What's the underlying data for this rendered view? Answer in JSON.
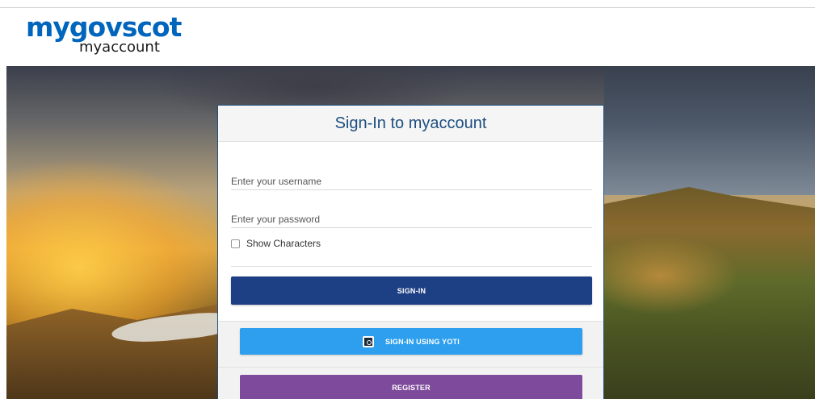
{
  "logo": {
    "main": "mygovscot",
    "sub": "myaccount"
  },
  "panel": {
    "title": "Sign-In to myaccount",
    "username_placeholder": "Enter your username",
    "password_placeholder": "Enter your password",
    "show_characters_label": "Show Characters",
    "show_characters_checked": false,
    "signin_label": "SIGN-IN",
    "yoti_label": "SIGN-IN USING YOTI",
    "register_label": "REGISTER"
  },
  "colors": {
    "brand_blue": "#0065bd",
    "title_blue": "#1d4e7f",
    "signin_button": "#1d3f84",
    "yoti_button": "#2d9fee",
    "register_button": "#7e4a9b"
  },
  "icons": {
    "yoti": "yoti-logo-icon"
  }
}
